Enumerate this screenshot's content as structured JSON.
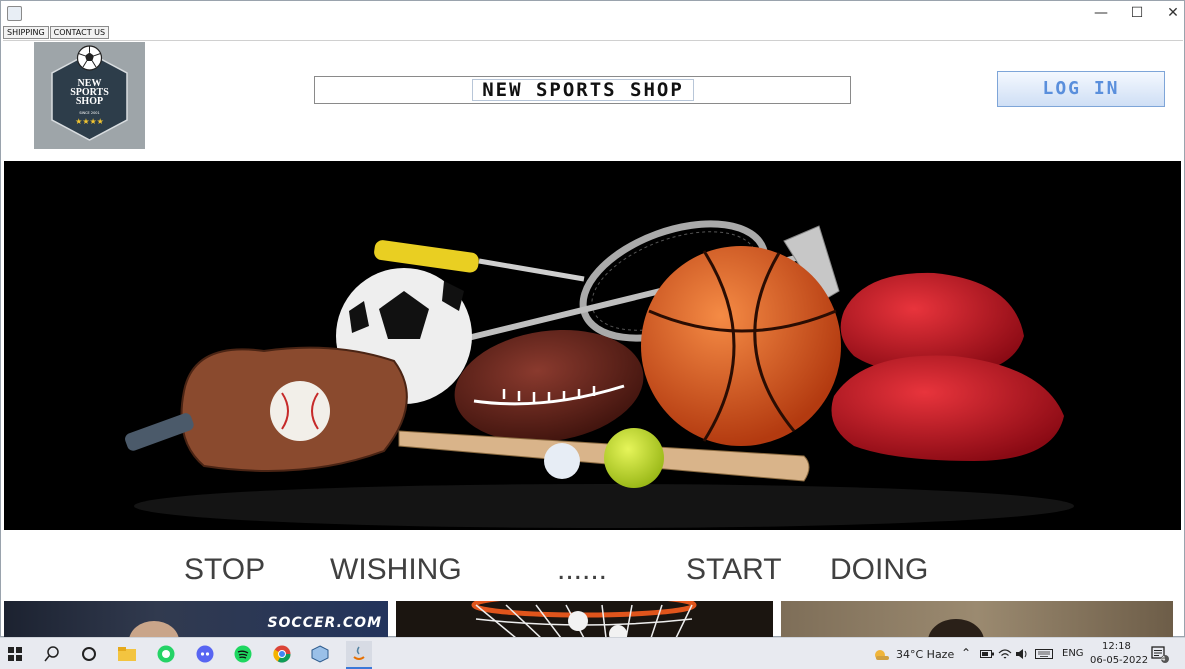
{
  "window": {
    "controls": {
      "minimize": "—",
      "maximize": "☐",
      "close": "✕"
    }
  },
  "menu": [
    "SHIPPING",
    "CONTACT US"
  ],
  "logo": {
    "line1": "NEW",
    "line2": "SPORTS",
    "line3": "SHOP",
    "since": "SINCE 2001",
    "stars": "★★★★"
  },
  "header": {
    "title": "NEW SPORTS SHOP",
    "login_label": "LOG IN"
  },
  "slogan": [
    "STOP",
    "WISHING",
    "......",
    "START",
    "DOING"
  ],
  "thumbs": {
    "soccer_logo": "SOCCER.COM"
  },
  "taskbar": {
    "weather": "34°C  Haze",
    "language": "ENG",
    "time": "12:18",
    "date": "06-05-2022",
    "notifications": "4"
  },
  "colors": {
    "login_text": "#5a8fdc",
    "logo_bg": "#9ea5a9",
    "hex_badge": "#2d3d4a",
    "hero_bg": "#000000"
  }
}
